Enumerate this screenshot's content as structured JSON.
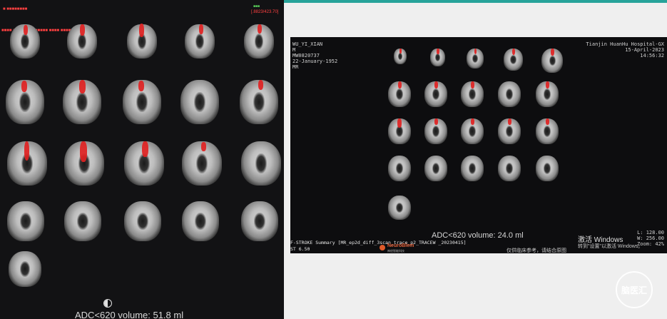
{
  "left": {
    "volume_label": "ADC<620 volume: 51.8 ml",
    "corner_text": "[.8823/423.70]",
    "half_circle_icon": "half-circle-icon"
  },
  "right": {
    "patient_name": "WU_YI_XIAN",
    "sex": "M",
    "patient_id": "MW0820737",
    "dob": "22-January-1952",
    "modality": "MR",
    "hospital": "Tianjin HuanHu Hospital-GX",
    "date": "15-April-2023",
    "time": "14:56:32",
    "volume_label": "ADC<620 volume: 24.0 ml",
    "summary_line": "F-STROKE Summary [MR_ep2d_diff_3scan_trace_p2_TRACEW _20230415]",
    "st_line": "ST 6.50",
    "activate_title": "激活 Windows",
    "activate_sub": "转到\"设置\"以激活 Windows。",
    "bottom_text": "仅供临床参考，请结合原图",
    "level": "L: 128.00",
    "width": "W: 256.00",
    "zoom": "Zoom: 42%",
    "logo_text": "NeuroBlem",
    "logo_sub": "神经智能科技",
    "watermark": "脑医汇"
  }
}
